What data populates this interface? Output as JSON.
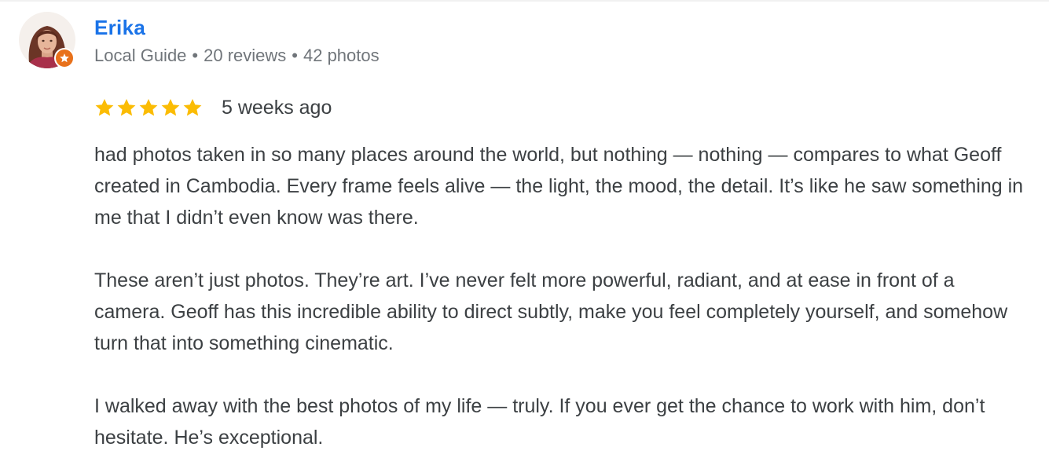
{
  "reviewer": {
    "name": "Erika",
    "badge": "Local Guide",
    "reviews": "20 reviews",
    "photos": "42 photos",
    "separator": "•"
  },
  "review": {
    "rating": 5,
    "max_rating": 5,
    "date": "5 weeks ago",
    "paragraphs": [
      "had photos taken in so many places around the world, but nothing — nothing — compares to what Geoff created in Cambodia. Every frame feels alive — the light, the mood, the detail. It’s like he saw something in me that I didn’t even know was there.",
      "These aren’t just photos. They’re art. I’ve never felt more powerful, radiant, and at ease in front of a camera. Geoff has this incredible ability to direct subtly, make you feel completely yourself, and somehow turn that into something cinematic.",
      "I walked away with the best photos of my life — truly. If you ever get the chance to work with him, don’t hesitate. He’s exceptional."
    ]
  },
  "icons": {
    "avatar": "reviewer-photo",
    "badge": "local-guide-star-icon",
    "star": "star-icon"
  },
  "colors": {
    "name": "#1a73e8",
    "meta": "#70757a",
    "body": "#3c4043",
    "star": "#fbbc04",
    "badge": "#e8711b"
  }
}
